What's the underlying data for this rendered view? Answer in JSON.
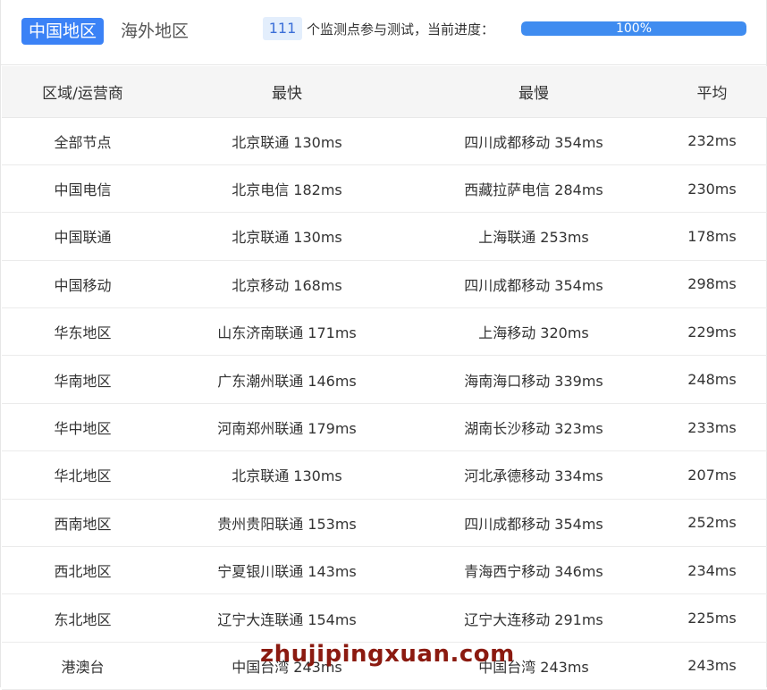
{
  "tabs": {
    "domestic": "中国地区",
    "overseas": "海外地区"
  },
  "progress": {
    "node_count": "111",
    "text": "个监测点参与测试，当前进度：",
    "label": "100%",
    "value": 1.0
  },
  "colors": {
    "accent": "#3b82f6",
    "watermark": "#8b1a10"
  },
  "table": {
    "headers": [
      "区域/运营商",
      "最快",
      "最慢",
      "平均"
    ],
    "rows": [
      [
        "全部节点",
        "北京联通 130ms",
        "四川成都移动 354ms",
        "232ms"
      ],
      [
        "中国电信",
        "北京电信 182ms",
        "西藏拉萨电信 284ms",
        "230ms"
      ],
      [
        "中国联通",
        "北京联通 130ms",
        "上海联通 253ms",
        "178ms"
      ],
      [
        "中国移动",
        "北京移动 168ms",
        "四川成都移动 354ms",
        "298ms"
      ],
      [
        "华东地区",
        "山东济南联通 171ms",
        "上海移动 320ms",
        "229ms"
      ],
      [
        "华南地区",
        "广东潮州联通 146ms",
        "海南海口移动 339ms",
        "248ms"
      ],
      [
        "华中地区",
        "河南郑州联通 179ms",
        "湖南长沙移动 323ms",
        "233ms"
      ],
      [
        "华北地区",
        "北京联通 130ms",
        "河北承德移动 334ms",
        "207ms"
      ],
      [
        "西南地区",
        "贵州贵阳联通 153ms",
        "四川成都移动 354ms",
        "252ms"
      ],
      [
        "西北地区",
        "宁夏银川联通 143ms",
        "青海西宁移动 346ms",
        "234ms"
      ],
      [
        "东北地区",
        "辽宁大连联通 154ms",
        "辽宁大连移动 291ms",
        "225ms"
      ],
      [
        "港澳台",
        "中国台湾 243ms",
        "中国台湾 243ms",
        "243ms"
      ]
    ]
  },
  "watermark": "zhujipingxuan.com"
}
